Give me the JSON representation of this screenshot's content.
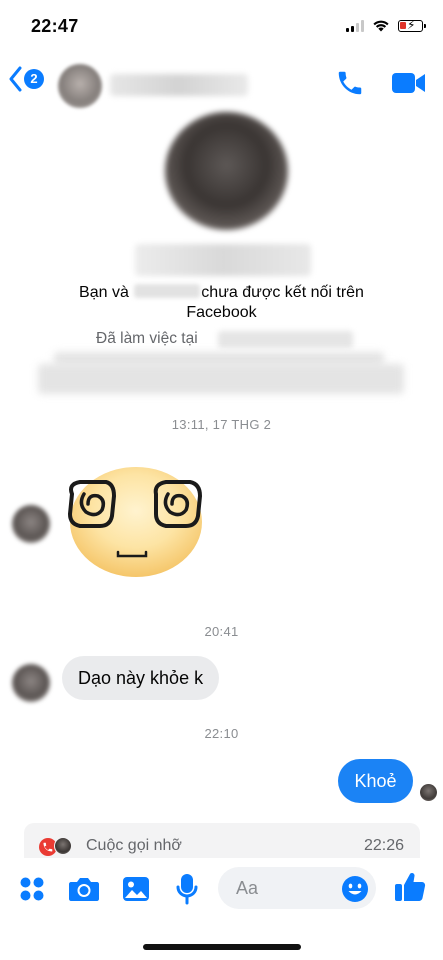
{
  "status_bar": {
    "time": "22:47",
    "signal_bars_on": 2,
    "signal_bars_total": 4,
    "battery_low": true,
    "charging": true
  },
  "header": {
    "unread_count": "2",
    "contact_name": "",
    "call_icon": "phone-icon",
    "video_icon": "video-camera-icon"
  },
  "profile": {
    "name": "",
    "connection_prefix": "Bạn và",
    "connection_suffix": "chưa được kết nối trên",
    "connection_line2": "Facebook",
    "work_prefix": "Đã làm việc tại"
  },
  "conversation": {
    "timestamps": [
      "13:11, 17 THG 2",
      "20:41",
      "22:10"
    ],
    "sticker": "dizzy-face-sticker",
    "incoming_message": "Dạo này khỏe k",
    "outgoing_message": "Khoẻ",
    "missed_call_label": "Cuộc gọi nhỡ",
    "missed_call_time": "22:26"
  },
  "composer": {
    "placeholder": "Aa",
    "icons": [
      "grid-menu-icon",
      "camera-icon",
      "image-icon",
      "microphone-icon",
      "emoji-icon",
      "thumbs-up-icon"
    ]
  },
  "colors": {
    "accent": "#0a7cff",
    "outgoing_bubble": "#1b83f5",
    "incoming_bubble": "#eaebed",
    "missed_call_red": "#ea3b33"
  }
}
